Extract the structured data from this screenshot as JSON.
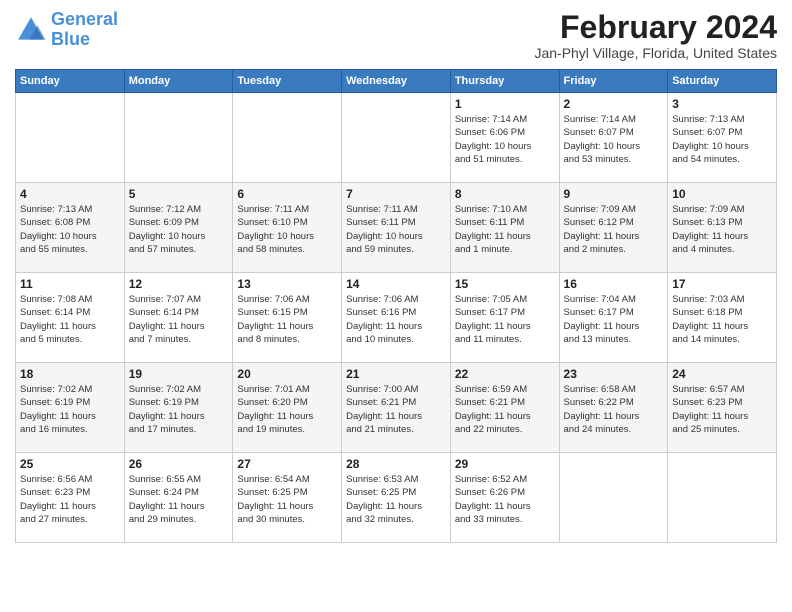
{
  "logo": {
    "line1": "General",
    "line2": "Blue"
  },
  "title": "February 2024",
  "location": "Jan-Phyl Village, Florida, United States",
  "weekdays": [
    "Sunday",
    "Monday",
    "Tuesday",
    "Wednesday",
    "Thursday",
    "Friday",
    "Saturday"
  ],
  "weeks": [
    [
      {
        "day": "",
        "info": ""
      },
      {
        "day": "",
        "info": ""
      },
      {
        "day": "",
        "info": ""
      },
      {
        "day": "",
        "info": ""
      },
      {
        "day": "1",
        "info": "Sunrise: 7:14 AM\nSunset: 6:06 PM\nDaylight: 10 hours\nand 51 minutes."
      },
      {
        "day": "2",
        "info": "Sunrise: 7:14 AM\nSunset: 6:07 PM\nDaylight: 10 hours\nand 53 minutes."
      },
      {
        "day": "3",
        "info": "Sunrise: 7:13 AM\nSunset: 6:07 PM\nDaylight: 10 hours\nand 54 minutes."
      }
    ],
    [
      {
        "day": "4",
        "info": "Sunrise: 7:13 AM\nSunset: 6:08 PM\nDaylight: 10 hours\nand 55 minutes."
      },
      {
        "day": "5",
        "info": "Sunrise: 7:12 AM\nSunset: 6:09 PM\nDaylight: 10 hours\nand 57 minutes."
      },
      {
        "day": "6",
        "info": "Sunrise: 7:11 AM\nSunset: 6:10 PM\nDaylight: 10 hours\nand 58 minutes."
      },
      {
        "day": "7",
        "info": "Sunrise: 7:11 AM\nSunset: 6:11 PM\nDaylight: 10 hours\nand 59 minutes."
      },
      {
        "day": "8",
        "info": "Sunrise: 7:10 AM\nSunset: 6:11 PM\nDaylight: 11 hours\nand 1 minute."
      },
      {
        "day": "9",
        "info": "Sunrise: 7:09 AM\nSunset: 6:12 PM\nDaylight: 11 hours\nand 2 minutes."
      },
      {
        "day": "10",
        "info": "Sunrise: 7:09 AM\nSunset: 6:13 PM\nDaylight: 11 hours\nand 4 minutes."
      }
    ],
    [
      {
        "day": "11",
        "info": "Sunrise: 7:08 AM\nSunset: 6:14 PM\nDaylight: 11 hours\nand 5 minutes."
      },
      {
        "day": "12",
        "info": "Sunrise: 7:07 AM\nSunset: 6:14 PM\nDaylight: 11 hours\nand 7 minutes."
      },
      {
        "day": "13",
        "info": "Sunrise: 7:06 AM\nSunset: 6:15 PM\nDaylight: 11 hours\nand 8 minutes."
      },
      {
        "day": "14",
        "info": "Sunrise: 7:06 AM\nSunset: 6:16 PM\nDaylight: 11 hours\nand 10 minutes."
      },
      {
        "day": "15",
        "info": "Sunrise: 7:05 AM\nSunset: 6:17 PM\nDaylight: 11 hours\nand 11 minutes."
      },
      {
        "day": "16",
        "info": "Sunrise: 7:04 AM\nSunset: 6:17 PM\nDaylight: 11 hours\nand 13 minutes."
      },
      {
        "day": "17",
        "info": "Sunrise: 7:03 AM\nSunset: 6:18 PM\nDaylight: 11 hours\nand 14 minutes."
      }
    ],
    [
      {
        "day": "18",
        "info": "Sunrise: 7:02 AM\nSunset: 6:19 PM\nDaylight: 11 hours\nand 16 minutes."
      },
      {
        "day": "19",
        "info": "Sunrise: 7:02 AM\nSunset: 6:19 PM\nDaylight: 11 hours\nand 17 minutes."
      },
      {
        "day": "20",
        "info": "Sunrise: 7:01 AM\nSunset: 6:20 PM\nDaylight: 11 hours\nand 19 minutes."
      },
      {
        "day": "21",
        "info": "Sunrise: 7:00 AM\nSunset: 6:21 PM\nDaylight: 11 hours\nand 21 minutes."
      },
      {
        "day": "22",
        "info": "Sunrise: 6:59 AM\nSunset: 6:21 PM\nDaylight: 11 hours\nand 22 minutes."
      },
      {
        "day": "23",
        "info": "Sunrise: 6:58 AM\nSunset: 6:22 PM\nDaylight: 11 hours\nand 24 minutes."
      },
      {
        "day": "24",
        "info": "Sunrise: 6:57 AM\nSunset: 6:23 PM\nDaylight: 11 hours\nand 25 minutes."
      }
    ],
    [
      {
        "day": "25",
        "info": "Sunrise: 6:56 AM\nSunset: 6:23 PM\nDaylight: 11 hours\nand 27 minutes."
      },
      {
        "day": "26",
        "info": "Sunrise: 6:55 AM\nSunset: 6:24 PM\nDaylight: 11 hours\nand 29 minutes."
      },
      {
        "day": "27",
        "info": "Sunrise: 6:54 AM\nSunset: 6:25 PM\nDaylight: 11 hours\nand 30 minutes."
      },
      {
        "day": "28",
        "info": "Sunrise: 6:53 AM\nSunset: 6:25 PM\nDaylight: 11 hours\nand 32 minutes."
      },
      {
        "day": "29",
        "info": "Sunrise: 6:52 AM\nSunset: 6:26 PM\nDaylight: 11 hours\nand 33 minutes."
      },
      {
        "day": "",
        "info": ""
      },
      {
        "day": "",
        "info": ""
      }
    ]
  ]
}
